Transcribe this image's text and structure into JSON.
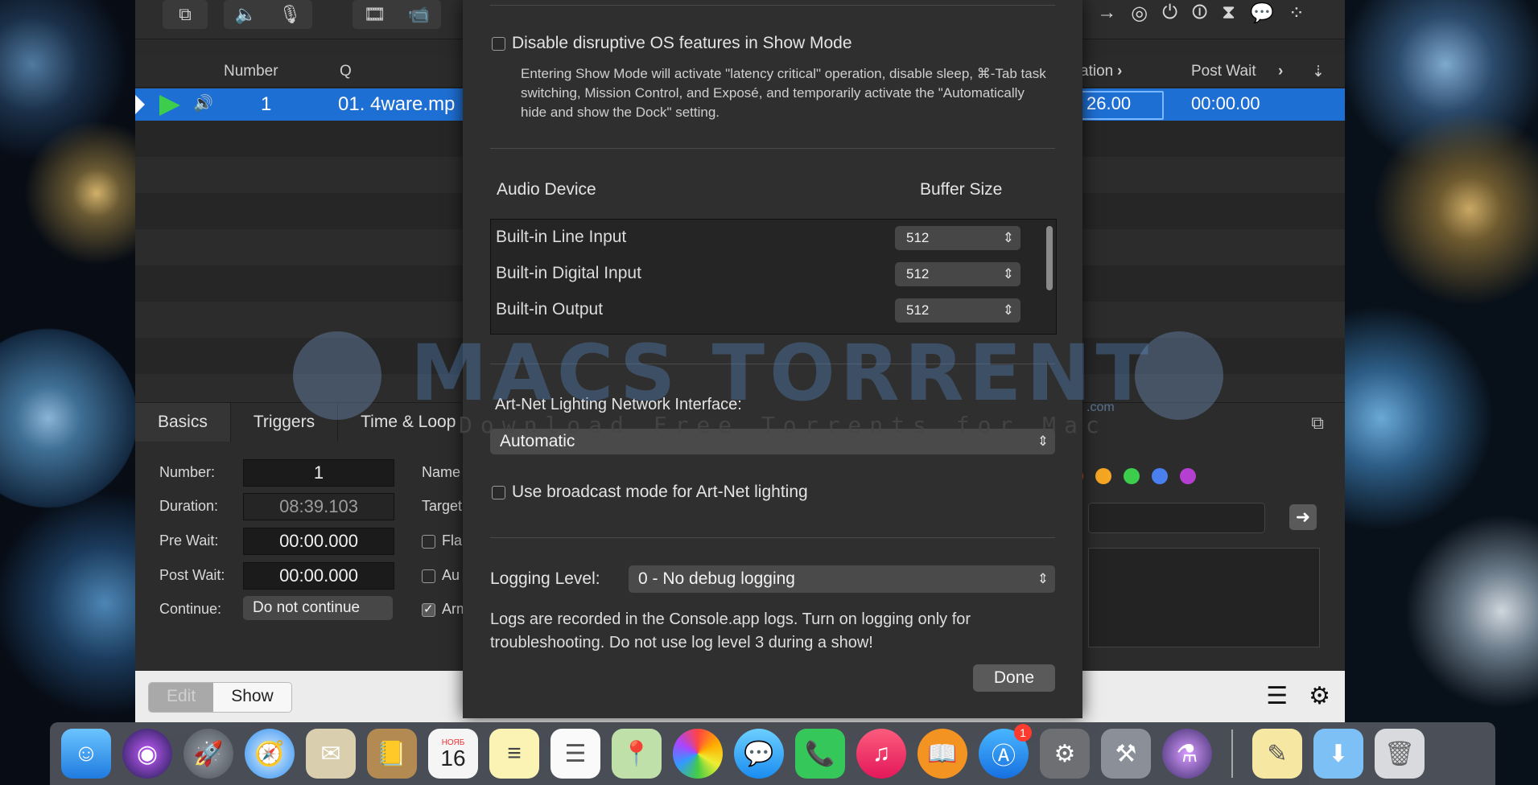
{
  "colors": {
    "selection": "#1e6fd4",
    "play": "#3ccd4d",
    "sheet_bg": "#2f2f2f"
  },
  "cue_list": {
    "headers": {
      "number": "Number",
      "q": "Q",
      "duration": "ation",
      "post_wait": "Post Wait"
    },
    "row": {
      "number": "1",
      "q": "01. 4ware.mp",
      "duration": "26.00",
      "post_wait": "00:00.00"
    }
  },
  "inspector": {
    "tabs": [
      "Basics",
      "Triggers",
      "Time & Loop"
    ],
    "number_label": "Number:",
    "number_value": "1",
    "duration_label": "Duration:",
    "duration_value": "08:39.103",
    "pre_wait_label": "Pre Wait:",
    "pre_wait_value": "00:00.000",
    "post_wait_label": "Post Wait:",
    "post_wait_value": "00:00.000",
    "continue_label": "Continue:",
    "continue_value": "Do not continue",
    "name_label": "Name",
    "target_label": "Target",
    "flag_label": "Fla",
    "auto_label": "Au",
    "armed_label": "Arm",
    "color_dots": [
      "#e8452c",
      "#f5a623",
      "#3ccd4d",
      "#4a7ff0",
      "#b53fd0"
    ]
  },
  "footer": {
    "edit_label": "Edit",
    "show_label": "Show"
  },
  "sheet": {
    "show_mode_label": "Disable disruptive OS features in Show Mode",
    "show_mode_desc": "Entering Show Mode will activate \"latency critical\" operation, disable sleep, ⌘-Tab task switching, Mission Control, and Exposé, and temporarily activate the \"Automatically hide and show the Dock\" setting.",
    "audio_device_header": "Audio Device",
    "buffer_size_header": "Buffer Size",
    "devices": [
      {
        "name": "Built-in Line Input",
        "buffer": "512"
      },
      {
        "name": "Built-in Digital Input",
        "buffer": "512"
      },
      {
        "name": "Built-in Output",
        "buffer": "512"
      }
    ],
    "artnet_label": "Art-Net Lighting Network Interface:",
    "artnet_value": "Automatic",
    "broadcast_label": "Use broadcast mode for Art-Net lighting",
    "logging_label": "Logging Level:",
    "logging_value": "0 - No debug logging",
    "logging_desc": "Logs are recorded in the Console.app logs. Turn on logging only for troubleshooting. Do not use log level 3 during a show!",
    "done_label": "Done"
  },
  "watermark": {
    "title": "MACS TORRENT",
    "subtitle": "Download Free Torrents for Mac",
    "suffix": ".com"
  },
  "dock": {
    "calendar_month": "НОЯБ",
    "calendar_day": "16",
    "appstore_badge": "1",
    "icons": [
      "finder-icon",
      "siri-icon",
      "launchpad-icon",
      "safari-icon",
      "mail-icon",
      "contacts-icon",
      "calendar-icon",
      "notes-icon",
      "reminders-icon",
      "maps-icon",
      "photos-icon",
      "messages-icon",
      "facetime-icon",
      "itunes-icon",
      "ibooks-icon",
      "appstore-icon",
      "system-preferences-icon",
      "xcode-icon",
      "qlab-icon",
      "textedit-icon",
      "downloads-icon",
      "trash-icon"
    ]
  }
}
